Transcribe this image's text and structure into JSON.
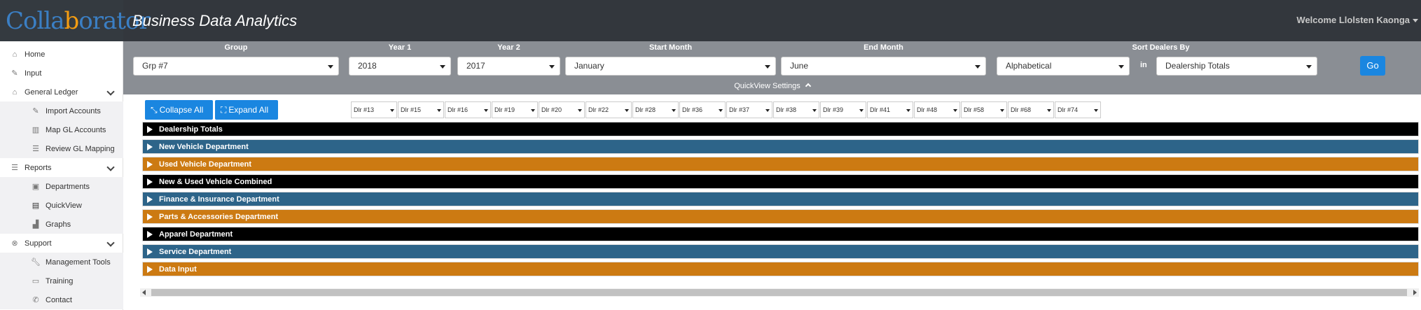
{
  "app": {
    "logo_part1": "Colla",
    "logo_part2": "b",
    "logo_part3": "orator",
    "title": "Business Data Analytics",
    "welcome": "Welcome Llolsten Kaonga"
  },
  "sidebar": {
    "items": [
      {
        "label": "Home",
        "icon": "home-icon"
      },
      {
        "label": "Input",
        "icon": "edit-icon"
      },
      {
        "label": "General Ledger",
        "icon": "bank-icon"
      },
      {
        "label": "Import Accounts",
        "icon": "edit-icon"
      },
      {
        "label": "Map GL Accounts",
        "icon": "map-icon"
      },
      {
        "label": "Review GL Mapping",
        "icon": "list-icon"
      },
      {
        "label": "Reports",
        "icon": "list-icon"
      },
      {
        "label": "Departments",
        "icon": "square-icon"
      },
      {
        "label": "QuickView",
        "icon": "quickview-icon"
      },
      {
        "label": "Graphs",
        "icon": "bar-chart-icon"
      },
      {
        "label": "Support",
        "icon": "lifebuoy-icon"
      },
      {
        "label": "Management Tools",
        "icon": "wrench-icon"
      },
      {
        "label": "Training",
        "icon": "monitor-icon"
      },
      {
        "label": "Contact",
        "icon": "phone-icon"
      }
    ]
  },
  "filters": {
    "group_label": "Group",
    "group_value": "Grp #7",
    "year1_label": "Year 1",
    "year1_value": "2018",
    "year2_label": "Year 2",
    "year2_value": "2017",
    "start_month_label": "Start Month",
    "start_month_value": "January",
    "end_month_label": "End Month",
    "end_month_value": "June",
    "sort_label": "Sort Dealers By",
    "sort_value": "Alphabetical",
    "in_label": "in",
    "sort_target_value": "Dealership Totals",
    "go_label": "Go",
    "quickview_settings": "QuickView Settings"
  },
  "actions": {
    "collapse_all": "Collapse All",
    "expand_all": "Expand All"
  },
  "dealers": [
    "Dlr #13",
    "Dlr #15",
    "Dlr #16",
    "Dlr #19",
    "Dlr #20",
    "Dlr #22",
    "Dlr #28",
    "Dlr #36",
    "Dlr #37",
    "Dlr #38",
    "Dlr #39",
    "Dlr #41",
    "Dlr #48",
    "Dlr #58",
    "Dlr #68",
    "Dlr #74"
  ],
  "sections": [
    {
      "label": "Dealership Totals",
      "color": "#000000"
    },
    {
      "label": "New Vehicle Department",
      "color": "#2d6489"
    },
    {
      "label": "Used Vehicle Department",
      "color": "#cc7a12"
    },
    {
      "label": "New & Used Vehicle Combined",
      "color": "#000000"
    },
    {
      "label": "Finance & Insurance Department",
      "color": "#2d6489"
    },
    {
      "label": "Parts & Accessories Department",
      "color": "#cc7a12"
    },
    {
      "label": "Apparel Department",
      "color": "#000000"
    },
    {
      "label": "Service Department",
      "color": "#2d6489"
    },
    {
      "label": "Data Input",
      "color": "#cc7a12"
    }
  ]
}
